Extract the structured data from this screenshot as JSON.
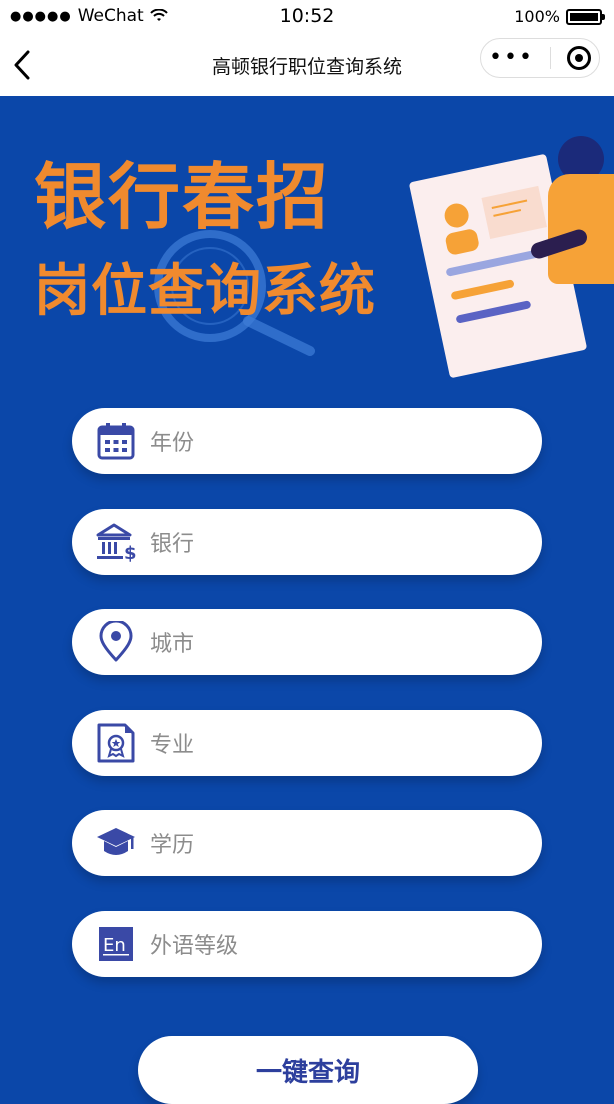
{
  "status": {
    "carrier": "WeChat",
    "time": "10:52",
    "battery": "100%"
  },
  "nav": {
    "title": "高顿银行职位查询系统"
  },
  "hero": {
    "title_line1": "银行春招",
    "title_line2": "岗位查询系统"
  },
  "form": {
    "fields": [
      {
        "label": "年份",
        "icon": "calendar-icon"
      },
      {
        "label": "银行",
        "icon": "bank-icon"
      },
      {
        "label": "城市",
        "icon": "location-pin-icon"
      },
      {
        "label": "专业",
        "icon": "certificate-icon"
      },
      {
        "label": "学历",
        "icon": "graduation-cap-icon"
      },
      {
        "label": "外语等级",
        "icon": "english-en-icon"
      }
    ],
    "submit_label": "一键查询"
  },
  "colors": {
    "background_blue": "#0b47a9",
    "accent_orange": "#f08a2e",
    "icon_indigo": "#3a49a6"
  }
}
